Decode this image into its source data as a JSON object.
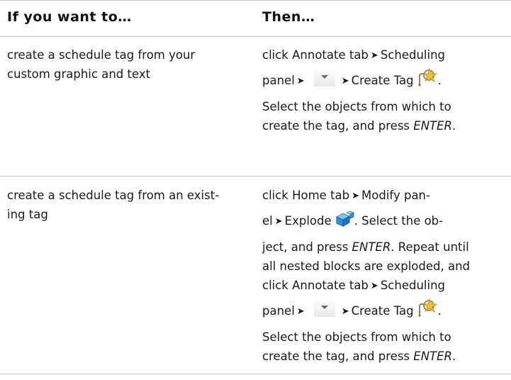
{
  "header": {
    "col1": "If you want to…",
    "col2": "Then…"
  },
  "rows": [
    {
      "want_lines": [
        "create a schedule tag from your",
        "custom graphic and text"
      ],
      "then": {
        "l1_a": "click Annotate tab",
        "l1_b": "Scheduling",
        "l2_a": "panel",
        "l2_b": "Create Tag",
        "l2_c": ".",
        "l3": "Select the objects from which to",
        "l4_a": "create the tag, and press ",
        "l4_em": "ENTER",
        "l4_b": "."
      }
    },
    {
      "want_lines": [
        "create a schedule tag from an exist-",
        "ing tag"
      ],
      "then": {
        "l1_a": "click Home tab",
        "l1_b": "Modify pan-",
        "l2_a": "el",
        "l2_b": "Explode",
        "l2_c": ". Select the ob-",
        "l3_a": "ject, and press ",
        "l3_em": "ENTER",
        "l3_b": ". Repeat until",
        "l4": "all nested blocks are exploded, and",
        "l5_a": "click Annotate tab",
        "l5_b": "Scheduling",
        "l6_a": "panel",
        "l6_b": "Create Tag",
        "l6_c": ".",
        "l7": "Select the objects from which to",
        "l8_a": "create the tag, and press ",
        "l8_em": "ENTER",
        "l8_b": "."
      }
    }
  ],
  "icons": {
    "arrow": "➤",
    "dropdown": "dropdown-arrow-icon",
    "create_tag": "create-tag-icon",
    "explode": "explode-icon"
  }
}
